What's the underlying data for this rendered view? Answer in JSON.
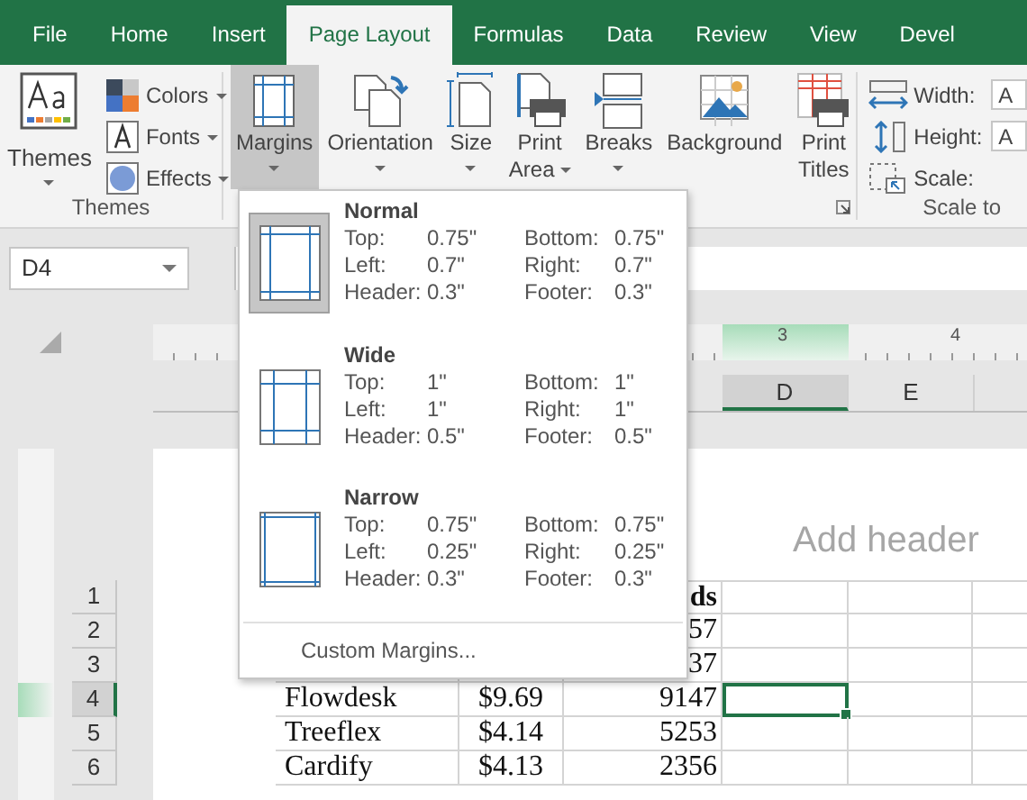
{
  "tabs": [
    {
      "label": "File",
      "selected": false
    },
    {
      "label": "Home",
      "selected": false
    },
    {
      "label": "Insert",
      "selected": false
    },
    {
      "label": "Page Layout",
      "selected": true
    },
    {
      "label": "Formulas",
      "selected": false
    },
    {
      "label": "Data",
      "selected": false
    },
    {
      "label": "Review",
      "selected": false
    },
    {
      "label": "View",
      "selected": false
    },
    {
      "label": "Devel",
      "selected": false
    }
  ],
  "themes_group": {
    "label": "Themes",
    "big_button": {
      "label": "Themes"
    },
    "small_buttons": [
      {
        "label": "Colors",
        "kind": "colors"
      },
      {
        "label": "Fonts",
        "kind": "fonts"
      },
      {
        "label": "Effects",
        "kind": "effects"
      }
    ]
  },
  "page_setup_group": {
    "buttons": [
      {
        "lines": [
          "Margins"
        ],
        "kind": "margins",
        "selected": true,
        "has_menu": true
      },
      {
        "lines": [
          "Orientation"
        ],
        "kind": "orientation",
        "selected": false,
        "has_menu": true
      },
      {
        "lines": [
          "Size"
        ],
        "kind": "size",
        "selected": false,
        "has_menu": true
      },
      {
        "lines": [
          "Print",
          "Area"
        ],
        "kind": "print_area",
        "selected": false,
        "has_menu": true
      },
      {
        "lines": [
          "Breaks"
        ],
        "kind": "breaks",
        "selected": false,
        "has_menu": true
      },
      {
        "lines": [
          "Background"
        ],
        "kind": "background",
        "selected": false,
        "has_menu": false
      },
      {
        "lines": [
          "Print",
          "Titles"
        ],
        "kind": "print_titles",
        "selected": false,
        "has_menu": false
      }
    ]
  },
  "scale_group": {
    "label": "Scale to",
    "fields": [
      {
        "label": "Width:",
        "kind": "width",
        "value": "A"
      },
      {
        "label": "Height:",
        "kind": "height",
        "value": "A"
      },
      {
        "label": "Scale:",
        "kind": "scale"
      }
    ]
  },
  "name_box": {
    "value": "D4"
  },
  "ruler": {
    "labels": [
      "3",
      "4"
    ]
  },
  "column_headers": [
    {
      "label": "D",
      "selected": true
    },
    {
      "label": "E",
      "selected": false
    }
  ],
  "row_headers": [
    {
      "label": "1",
      "selected": false
    },
    {
      "label": "2",
      "selected": false
    },
    {
      "label": "3",
      "selected": false
    },
    {
      "label": "4",
      "selected": true
    },
    {
      "label": "5",
      "selected": false
    },
    {
      "label": "6",
      "selected": false
    }
  ],
  "page": {
    "header_placeholder": "Add header"
  },
  "rows": [
    {
      "kind": "header",
      "count": "ds",
      "selected": false
    },
    {
      "kind": "data",
      "count": "57",
      "selected": false
    },
    {
      "kind": "data",
      "count": "37",
      "selected": false
    },
    {
      "kind": "data",
      "name": "Flowdesk",
      "price": "$9.69",
      "count": "9147",
      "selected": true
    },
    {
      "kind": "data",
      "name": "Treeflex",
      "price": "$4.14",
      "count": "5253",
      "selected": false
    },
    {
      "kind": "data",
      "name": "Cardify",
      "price": "$4.13",
      "count": "2356",
      "selected": false
    }
  ],
  "margins_menu": {
    "presets": [
      {
        "name": "Normal",
        "kind": "normal",
        "selected": true,
        "left": [
          {
            "label": "Top:",
            "value": "0.75\""
          },
          {
            "label": "Left:",
            "value": "0.7\""
          },
          {
            "label": "Header:",
            "value": "0.3\""
          }
        ],
        "right": [
          {
            "label": "Bottom:",
            "value": "0.75\""
          },
          {
            "label": "Right:",
            "value": "0.7\""
          },
          {
            "label": "Footer:",
            "value": "0.3\""
          }
        ]
      },
      {
        "name": "Wide",
        "kind": "wide",
        "selected": false,
        "left": [
          {
            "label": "Top:",
            "value": "1\""
          },
          {
            "label": "Left:",
            "value": "1\""
          },
          {
            "label": "Header:",
            "value": "0.5\""
          }
        ],
        "right": [
          {
            "label": "Bottom:",
            "value": "1\""
          },
          {
            "label": "Right:",
            "value": "1\""
          },
          {
            "label": "Footer:",
            "value": "0.5\""
          }
        ]
      },
      {
        "name": "Narrow",
        "kind": "narrow",
        "selected": false,
        "left": [
          {
            "label": "Top:",
            "value": "0.75\""
          },
          {
            "label": "Left:",
            "value": "0.25\""
          },
          {
            "label": "Header:",
            "value": "0.3\""
          }
        ],
        "right": [
          {
            "label": "Bottom:",
            "value": "0.75\""
          },
          {
            "label": "Right:",
            "value": "0.25\""
          },
          {
            "label": "Footer:",
            "value": "0.3\""
          }
        ]
      }
    ],
    "footer": "Custom Margins..."
  }
}
